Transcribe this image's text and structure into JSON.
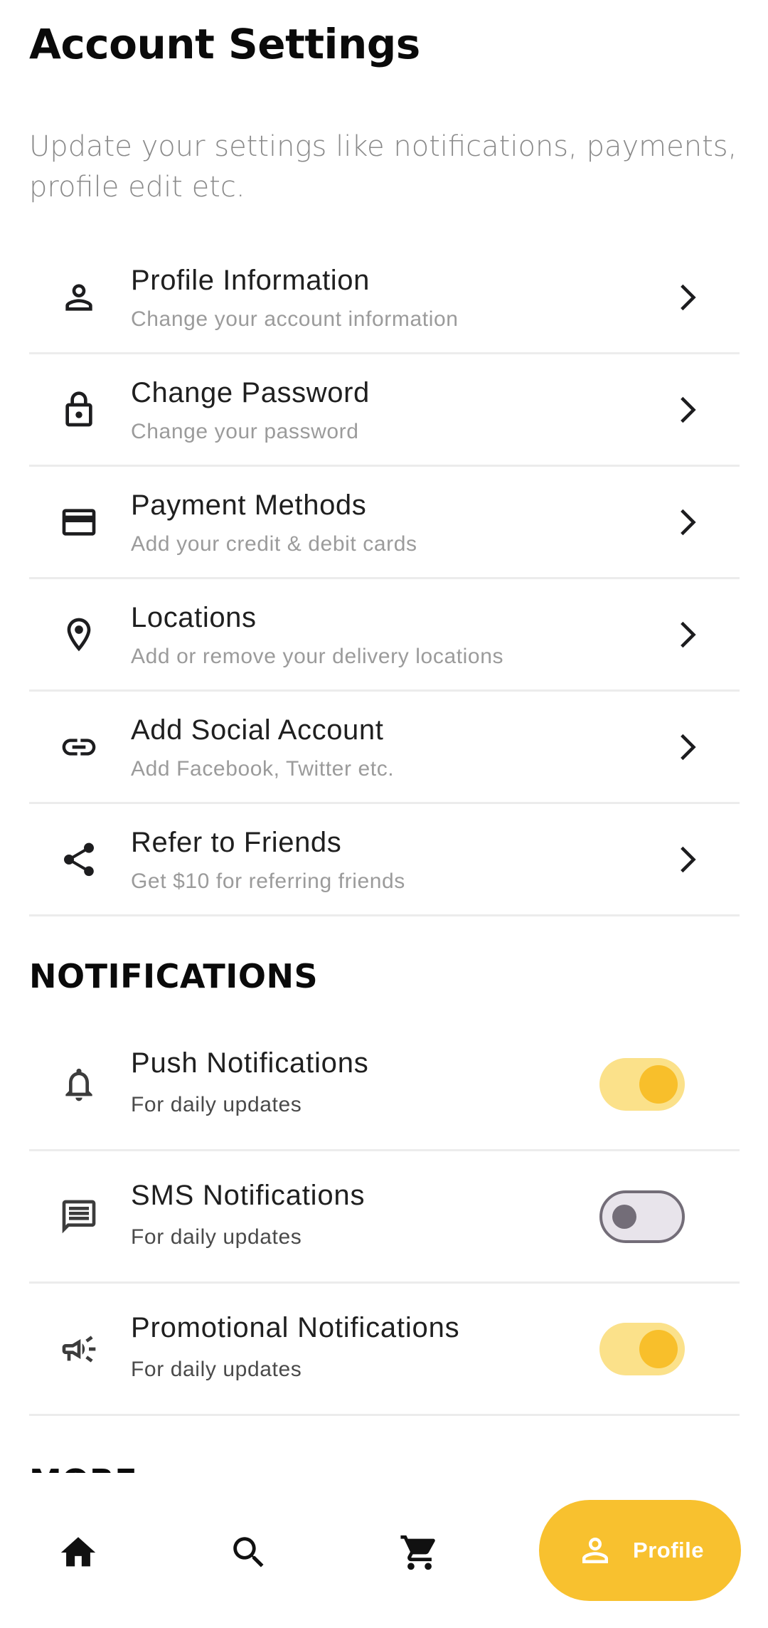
{
  "page": {
    "title": "Account Settings",
    "subtitle": "Update your settings like notifications, payments, profile edit etc."
  },
  "settings": [
    {
      "icon": "person-icon",
      "title": "Profile Information",
      "subtitle": "Change your account information"
    },
    {
      "icon": "lock-icon",
      "title": "Change Password",
      "subtitle": "Change your password"
    },
    {
      "icon": "credit-card-icon",
      "title": "Payment Methods",
      "subtitle": "Add your credit & debit cards"
    },
    {
      "icon": "location-pin-icon",
      "title": "Locations",
      "subtitle": "Add or remove your delivery locations"
    },
    {
      "icon": "link-icon",
      "title": "Add Social Account",
      "subtitle": "Add Facebook, Twitter etc."
    },
    {
      "icon": "share-icon",
      "title": "Refer to Friends",
      "subtitle": "Get $10 for referring friends"
    }
  ],
  "notifications": {
    "header": "NOTIFICATIONS",
    "items": [
      {
        "icon": "bell-icon",
        "title": "Push Notifications",
        "subtitle": "For daily updates",
        "enabled": true
      },
      {
        "icon": "message-icon",
        "title": "SMS Notifications",
        "subtitle": "For daily updates",
        "enabled": false
      },
      {
        "icon": "megaphone-icon",
        "title": "Promotional Notifications",
        "subtitle": "For daily updates",
        "enabled": true
      }
    ]
  },
  "more": {
    "header": "MORE"
  },
  "bottom_nav": {
    "items": [
      {
        "icon": "home-icon"
      },
      {
        "icon": "search-icon"
      },
      {
        "icon": "cart-icon"
      }
    ],
    "active": {
      "icon": "person-icon",
      "label": "Profile"
    }
  },
  "colors": {
    "accent": "#f8c12f",
    "toggle_track_on": "#fbe18a",
    "toggle_knob_on": "#f8bf2b",
    "toggle_off": "#736d78",
    "divider": "#ececec",
    "subtitle_gray": "#9b9b9b"
  }
}
